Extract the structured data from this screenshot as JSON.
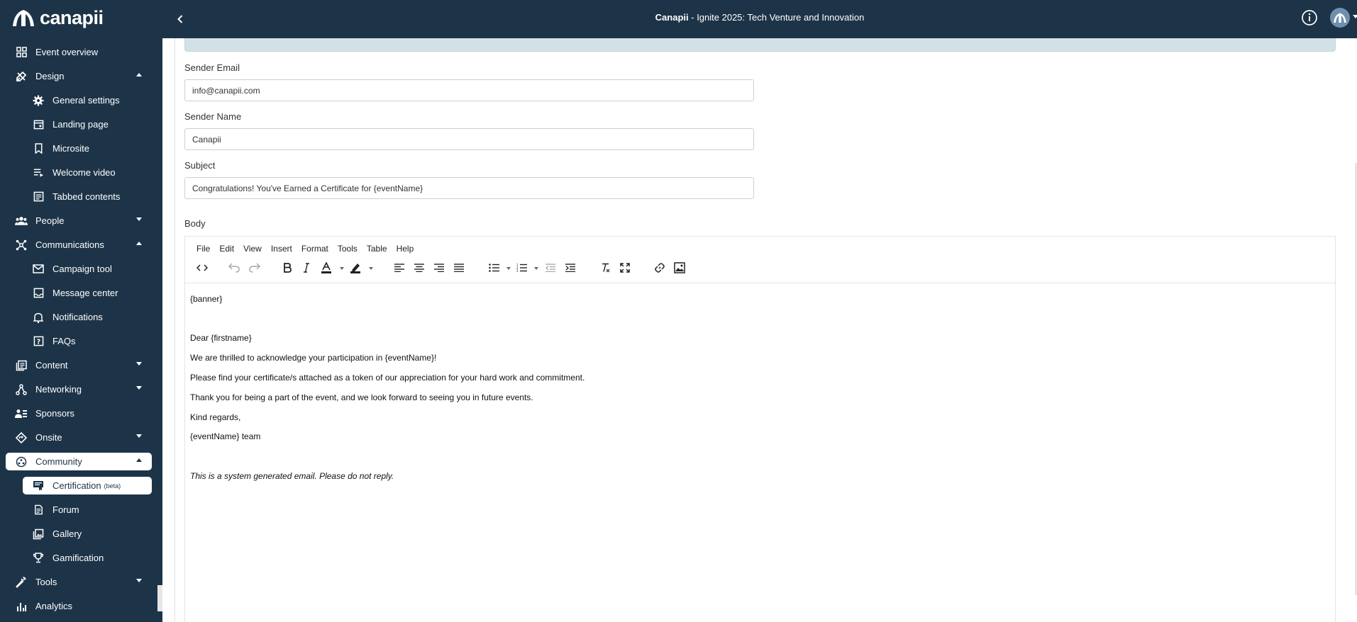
{
  "brand": {
    "name": "canapii"
  },
  "header": {
    "event_brand": "Canapii",
    "event_title": " - Ignite 2025: Tech Venture and Innovation"
  },
  "sidebar": {
    "items": [
      {
        "label": "Event overview",
        "icon": "grid-icon"
      },
      {
        "label": "Design",
        "icon": "design-icon",
        "expanded": true
      },
      {
        "label": "General settings",
        "icon": "gear-icon"
      },
      {
        "label": "Landing page",
        "icon": "calendar-icon"
      },
      {
        "label": "Microsite",
        "icon": "bookmark-icon"
      },
      {
        "label": "Welcome video",
        "icon": "playlist-icon"
      },
      {
        "label": "Tabbed contents",
        "icon": "tabs-icon"
      },
      {
        "label": "People",
        "icon": "people-icon",
        "expanded": false
      },
      {
        "label": "Communications",
        "icon": "hub-icon",
        "expanded": true
      },
      {
        "label": "Campaign tool",
        "icon": "mail-icon"
      },
      {
        "label": "Message center",
        "icon": "inbox-icon"
      },
      {
        "label": "Notifications",
        "icon": "bell-icon"
      },
      {
        "label": "FAQs",
        "icon": "question-icon"
      },
      {
        "label": "Content",
        "icon": "library-icon",
        "expanded": false
      },
      {
        "label": "Networking",
        "icon": "network-icon",
        "expanded": false
      },
      {
        "label": "Sponsors",
        "icon": "sponsors-icon"
      },
      {
        "label": "Onsite",
        "icon": "diamond-icon",
        "expanded": false
      },
      {
        "label": "Community",
        "icon": "community-icon",
        "expanded": true,
        "active": true
      },
      {
        "label": "Certification",
        "badge": "(beta)",
        "icon": "certificate-icon",
        "active": true
      },
      {
        "label": "Forum",
        "icon": "forum-icon"
      },
      {
        "label": "Gallery",
        "icon": "gallery-icon"
      },
      {
        "label": "Gamification",
        "icon": "trophy-icon"
      },
      {
        "label": "Tools",
        "icon": "wrench-icon",
        "expanded": false
      },
      {
        "label": "Analytics",
        "icon": "chart-icon"
      }
    ]
  },
  "form": {
    "sender_email_label": "Sender Email",
    "sender_email_value": "info@canapii.com",
    "sender_name_label": "Sender Name",
    "sender_name_value": "Canapii",
    "subject_label": "Subject",
    "subject_value": "Congratulations! You've Earned a Certificate for {eventName}",
    "body_label": "Body"
  },
  "editor": {
    "menu": [
      "File",
      "Edit",
      "View",
      "Insert",
      "Format",
      "Tools",
      "Table",
      "Help"
    ],
    "lines": [
      "{banner}",
      "Dear {firstname}",
      "We are thrilled to acknowledge your participation in {eventName}!",
      "Please find your certificate/s attached as a token of our appreciation for your hard work and commitment.",
      "Thank you for being a part of the event, and we look forward to seeing you in future events.",
      "Kind regards,",
      "{eventName} team",
      "This is a system generated email. Please do not reply."
    ]
  },
  "colors": {
    "sidebar_bg": "#1d3448",
    "active_bg": "#ffffff",
    "banner_strip": "#d3e1e6"
  }
}
